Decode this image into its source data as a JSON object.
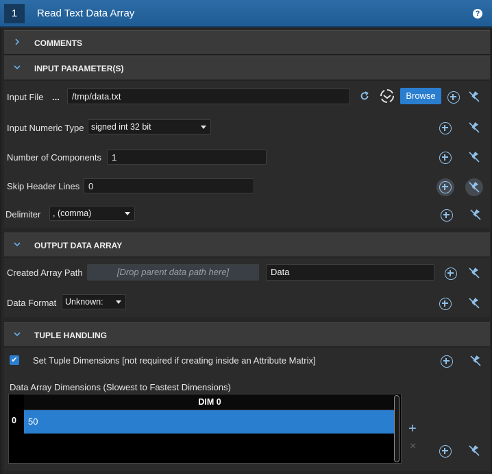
{
  "window": {
    "index": "1",
    "title": "Read Text Data Array",
    "help": "?"
  },
  "sections": {
    "comments": {
      "label": "COMMENTS"
    },
    "input": {
      "label": "INPUT PARAMETER(S)",
      "input_file": {
        "label": "Input File",
        "dots": "...",
        "value": "/tmp/data.txt",
        "browse": "Browse"
      },
      "numeric_type": {
        "label": "Input Numeric Type",
        "value": "signed int 32 bit"
      },
      "num_components": {
        "label": "Number of Components",
        "value": "1"
      },
      "skip_header": {
        "label": "Skip Header Lines",
        "value": "0"
      },
      "delimiter": {
        "label": "Delimiter",
        "value": ", (comma)"
      }
    },
    "output": {
      "label": "OUTPUT DATA ARRAY",
      "created_path": {
        "label": "Created Array Path",
        "placeholder": "[Drop parent data path here]",
        "value": "Data"
      },
      "data_format": {
        "label": "Data Format",
        "value": "Unknown:"
      }
    },
    "tuple": {
      "label": "TUPLE HANDLING",
      "set_dims": {
        "label": "Set Tuple Dimensions [not required if creating inside an Attribute Matrix]",
        "checked": true,
        "check": "✔"
      },
      "dims_title": "Data Array Dimensions (Slowest to Fastest Dimensions)",
      "table": {
        "header": "DIM 0",
        "rows": [
          {
            "index": "0",
            "value": "50"
          }
        ]
      },
      "add": "+",
      "remove": "×"
    }
  },
  "colors": {
    "accent": "#2a7ed0",
    "title_bar": "#1f5c96",
    "icon": "#8fc0ea"
  }
}
